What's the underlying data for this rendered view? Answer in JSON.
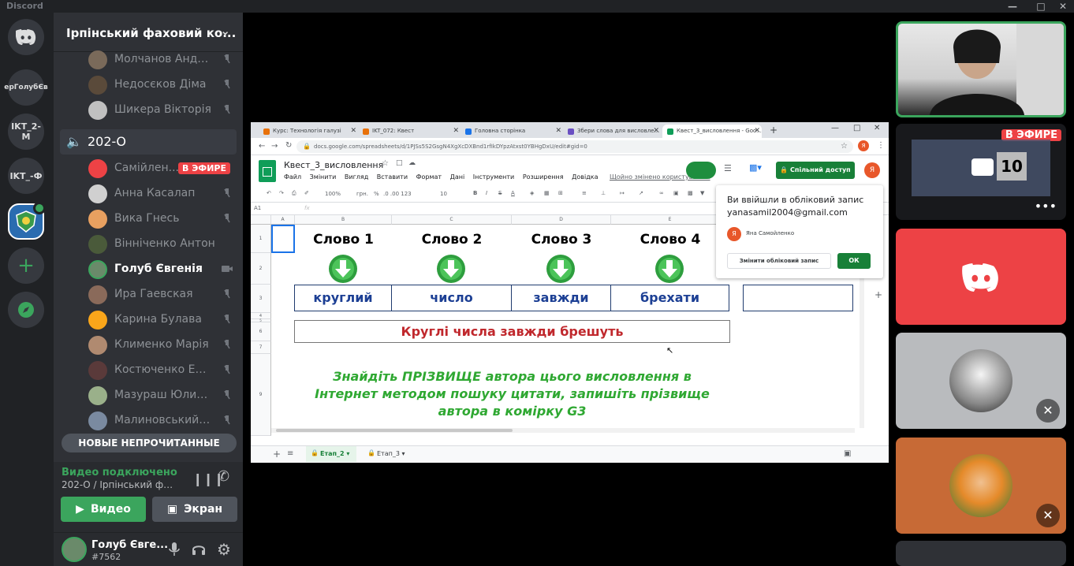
{
  "window": {
    "title": "Discord"
  },
  "servers": [
    {
      "label": "ерГолубЄв"
    },
    {
      "label": "IKT_2-M"
    },
    {
      "label": "IKT_-Ф"
    }
  ],
  "guild": {
    "name": "Ірпінський фаховий ко..."
  },
  "members_top": [
    {
      "name": "Молчанов Андрей",
      "avatar_color": "#7a6a5a"
    },
    {
      "name": "Недосєков Діма",
      "avatar_color": "#5a4a3a"
    },
    {
      "name": "Шикера Вікторія",
      "avatar_color": "#c0c0c0"
    }
  ],
  "voice_channel": {
    "name": "202-О"
  },
  "members": [
    {
      "name": "Самійлен...",
      "avatar_color": "#ed4245",
      "badge": "В ЭФИРЕ"
    },
    {
      "name": "Анна Касалап",
      "avatar_color": "#d0d0d0"
    },
    {
      "name": "Вика Гнесь",
      "avatar_color": "#e8a060"
    },
    {
      "name": "Вінніченко Антон",
      "avatar_color": "#4a5a3a"
    },
    {
      "name": "Голуб Євгенія",
      "avatar_color": "#6a8a6a"
    },
    {
      "name": "Ира Гаевская",
      "avatar_color": "#8a6a5a"
    },
    {
      "name": "Карина Булава",
      "avatar_color": "#faa61a"
    },
    {
      "name": "Клименко Марія",
      "avatar_color": "#b08a70"
    },
    {
      "name": "Костюченко Елиза...",
      "avatar_color": "#5a3a3a"
    },
    {
      "name": "Мазураш Юлиана",
      "avatar_color": "#9ab08a"
    },
    {
      "name": "Малиновський Ки...",
      "avatar_color": "#7a8aa0"
    }
  ],
  "unread_label": "НОВЫЕ НЕПРОЧИТАННЫЕ",
  "voice_status": {
    "title": "Видео подключено",
    "channel": "202-О / Ірпінський фахов..."
  },
  "buttons": {
    "video": "Видео",
    "screen": "Экран"
  },
  "user": {
    "name": "Голуб Євге...",
    "tag": "#7562"
  },
  "tiles": {
    "live_badge": "В ЭФИРЕ",
    "timer": "10"
  },
  "browser": {
    "tabs": [
      {
        "label": "Курс: Технологія галузі",
        "color": "#e8710a"
      },
      {
        "label": "IKT_072: Квест",
        "color": "#e8710a"
      },
      {
        "label": "Головна сторінка",
        "color": "#1a73e8"
      },
      {
        "label": "Збери слова для висловле...",
        "color": "#6a4fc2"
      },
      {
        "label": "Квест_3_висловлення - Goo...",
        "color": "#0f9d58"
      }
    ],
    "url": "docs.google.com/spreadsheets/d/1PJSs5S2GsgN4XgXcDXBnd1rfIkDYpzAtxst0YBHgDxU/edit#gid=0",
    "doc_title": "Квест_3_висловлення",
    "menu": [
      "Файл",
      "Змінити",
      "Вигляд",
      "Вставити",
      "Формат",
      "Дані",
      "Інструменти",
      "Розширення",
      "Довідка"
    ],
    "last_edit": "Щойно змінено користуваче...",
    "share_label": "Спільний доступ",
    "avatar_letter": "Я",
    "zoom": "100%",
    "currency": "грн.",
    "percent": "%",
    "decimals": ".0  .00  123",
    "font_size": "10",
    "cell_ref": "A1",
    "fx": "fx",
    "columns": [
      "A",
      "B",
      "C",
      "D",
      "E"
    ],
    "rows": [
      "1",
      "2",
      "3",
      "4",
      "5",
      "6",
      "7",
      "9"
    ],
    "words_header": [
      "Слово 1",
      "Слово 2",
      "Слово 3",
      "Слово 4"
    ],
    "words": [
      "круглий",
      "число",
      "завжди",
      "брехати"
    ],
    "answer": "Круглі числа завжди брешуть",
    "task_lines": [
      "Знайдіть ПРІЗВИЩЕ автора цього висловлення в",
      "Інтернет методом пошуку цитати, запишіть прізвище",
      "автора в комірку G3"
    ],
    "sheets": [
      "Етап_2",
      "Етап_3"
    ],
    "popup": {
      "title": "Ви ввійшли в обліковий запис",
      "email": "yanasamil2004@gmail.com",
      "account": "Яна Самойленко",
      "switch_label": "Змінити обліковий запис",
      "ok_label": "ОК"
    }
  },
  "colors": {
    "discord_blurple": "#5865f2",
    "green": "#3ba55d",
    "red": "#ed4245",
    "sheets_green": "#188038"
  }
}
